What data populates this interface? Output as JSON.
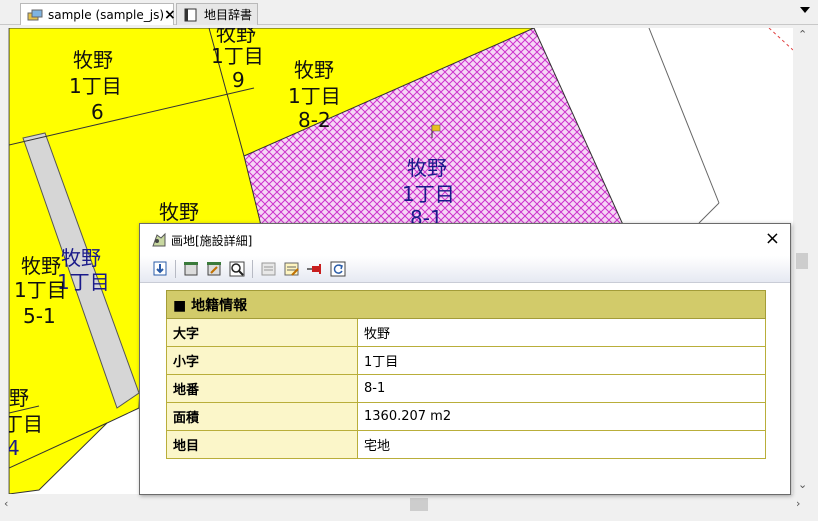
{
  "tabs": [
    {
      "label": "sample (sample_js)",
      "close": "×",
      "active": true
    },
    {
      "label": "地目辞書",
      "active": false
    }
  ],
  "map": {
    "labels": [
      {
        "text": "牧野",
        "id": "l1"
      },
      {
        "text": "1丁目",
        "id": "l2"
      },
      {
        "text": "6",
        "id": "l3"
      },
      {
        "text": "牧野",
        "id": "l4"
      },
      {
        "text": "1丁目",
        "id": "l5"
      },
      {
        "text": "9",
        "id": "l6"
      },
      {
        "text": "牧野",
        "id": "l7"
      },
      {
        "text": "1丁目",
        "id": "l8"
      },
      {
        "text": "8-2",
        "id": "l9"
      },
      {
        "text": "牧野",
        "id": "l10"
      },
      {
        "text": "1丁目",
        "id": "l11"
      },
      {
        "text": "8-1",
        "id": "l12"
      },
      {
        "text": "牧野",
        "id": "l13"
      },
      {
        "text": "牧野",
        "id": "l14"
      },
      {
        "text": "1丁目",
        "id": "l15"
      },
      {
        "text": "牧野",
        "id": "l16"
      },
      {
        "text": "1丁目",
        "id": "l17"
      },
      {
        "text": "5-1",
        "id": "l18"
      },
      {
        "text": "野",
        "id": "l19"
      },
      {
        "text": "丁目",
        "id": "l20"
      },
      {
        "text": "4",
        "id": "l21"
      }
    ],
    "colors": {
      "parcel": "#ffff00",
      "selected_hatch": "#cc33cc",
      "road": "#d6d6d6"
    }
  },
  "dialog": {
    "title": "画地[施設詳細]",
    "close": "×",
    "section_title": "■ 地籍情報",
    "rows": [
      {
        "key": "大字",
        "value": "牧野"
      },
      {
        "key": "小字",
        "value": "1丁目"
      },
      {
        "key": "地番",
        "value": "8-1"
      },
      {
        "key": "面積",
        "value": "1360.207 m2"
      },
      {
        "key": "地目",
        "value": "宅地"
      }
    ],
    "toolbar_icons": [
      "export-icon",
      "facility-icon",
      "facility-edit-icon",
      "search-icon",
      "list-icon",
      "list-edit-icon",
      "pin-icon",
      "refresh-icon"
    ]
  }
}
